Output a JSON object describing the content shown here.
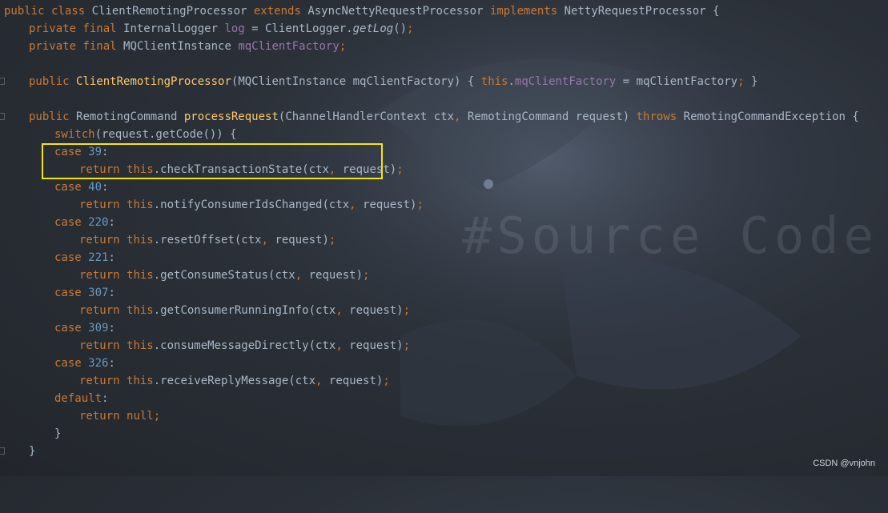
{
  "watermark": "#Source Code",
  "credit": "CSDN @vnjohn",
  "colors": {
    "keyword": "#cc7832",
    "method_decl": "#ffc66d",
    "field": "#9876aa",
    "number": "#6897bb",
    "default_text": "#a9b7c6",
    "highlight_border": "#f5e60a",
    "background": "#2b3038"
  },
  "code": {
    "l1": {
      "kw1": "public class ",
      "t1": "ClientRemotingProcessor ",
      "kw2": "extends ",
      "t2": "AsyncNettyRequestProcessor ",
      "kw3": "implements ",
      "t3": "NettyRequestProcessor {"
    },
    "l2": {
      "kw": "private final ",
      "t1": "InternalLogger ",
      "field": "log",
      "t2": " = ClientLogger.",
      "call": "getLog",
      "t3": "()",
      "semi": ";"
    },
    "l3": {
      "kw": "private final ",
      "t1": "MQClientInstance ",
      "field": "mqClientFactory",
      "semi": ";"
    },
    "l5": {
      "kw": "public ",
      "fn": "ClientRemotingProcessor",
      "t1": "(MQClientInstance mqClientFactory) { ",
      "kw2": "this",
      "t2": ".",
      "field": "mqClientFactory",
      "t3": " = mqClientFactory",
      "semi": ";",
      "t4": " }"
    },
    "l7": {
      "kw": "public ",
      "t1": "RemotingCommand ",
      "fn": "processRequest",
      "t2": "(ChannelHandlerContext ctx",
      "c1": ", ",
      "t3": "RemotingCommand request) ",
      "kw2": "throws ",
      "t4": "RemotingCommandException {"
    },
    "l8": {
      "kw": "switch",
      "t1": "(request.getCode()) {"
    },
    "cases": [
      {
        "case_kw": "case ",
        "num": "39",
        "colon": ":",
        "ret_kw": "return ",
        "this_kw": "this",
        "call": ".checkTransactionState(ctx",
        "comma": ", ",
        "args": "request)",
        "semi": ";"
      },
      {
        "case_kw": "case ",
        "num": "40",
        "colon": ":",
        "ret_kw": "return ",
        "this_kw": "this",
        "call": ".notifyConsumerIdsChanged(ctx",
        "comma": ", ",
        "args": "request)",
        "semi": ";"
      },
      {
        "case_kw": "case ",
        "num": "220",
        "colon": ":",
        "ret_kw": "return ",
        "this_kw": "this",
        "call": ".resetOffset(ctx",
        "comma": ", ",
        "args": "request)",
        "semi": ";"
      },
      {
        "case_kw": "case ",
        "num": "221",
        "colon": ":",
        "ret_kw": "return ",
        "this_kw": "this",
        "call": ".getConsumeStatus(ctx",
        "comma": ", ",
        "args": "request)",
        "semi": ";"
      },
      {
        "case_kw": "case ",
        "num": "307",
        "colon": ":",
        "ret_kw": "return ",
        "this_kw": "this",
        "call": ".getConsumerRunningInfo(ctx",
        "comma": ", ",
        "args": "request)",
        "semi": ";"
      },
      {
        "case_kw": "case ",
        "num": "309",
        "colon": ":",
        "ret_kw": "return ",
        "this_kw": "this",
        "call": ".consumeMessageDirectly(ctx",
        "comma": ", ",
        "args": "request)",
        "semi": ";"
      },
      {
        "case_kw": "case ",
        "num": "326",
        "colon": ":",
        "ret_kw": "return ",
        "this_kw": "this",
        "call": ".receiveReplyMessage(ctx",
        "comma": ", ",
        "args": "request)",
        "semi": ";"
      }
    ],
    "default_line": {
      "kw": "default",
      "colon": ":"
    },
    "return_null": {
      "kw1": "return ",
      "kw2": "null",
      "semi": ";"
    },
    "close1": "}",
    "close2": "}"
  }
}
